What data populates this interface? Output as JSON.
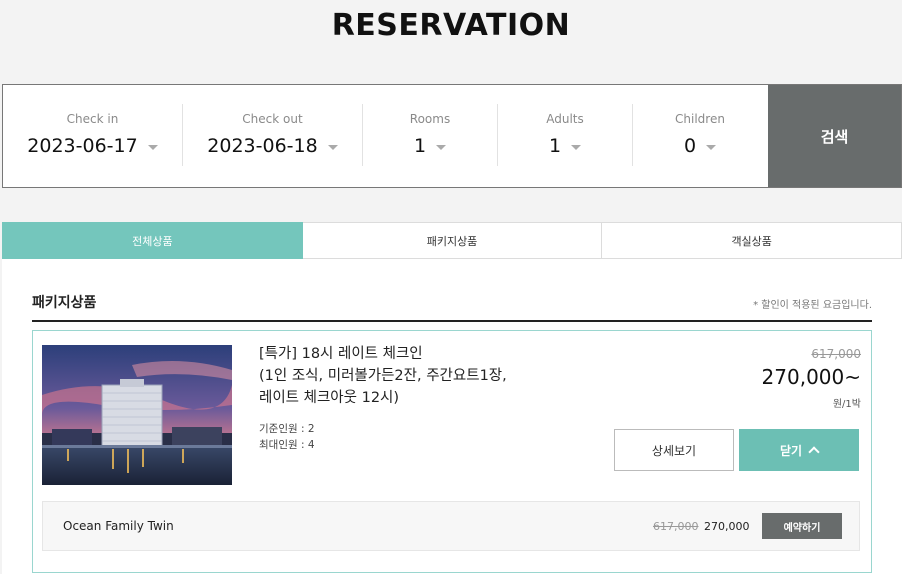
{
  "page": {
    "title": "RESERVATION"
  },
  "search": {
    "check_in": {
      "label": "Check in",
      "value": "2023-06-17"
    },
    "check_out": {
      "label": "Check out",
      "value": "2023-06-18"
    },
    "rooms": {
      "label": "Rooms",
      "value": "1"
    },
    "adults": {
      "label": "Adults",
      "value": "1"
    },
    "children": {
      "label": "Children",
      "value": "0"
    },
    "button_label": "검색"
  },
  "tabs": [
    {
      "label": "전체상품",
      "active": true
    },
    {
      "label": "패키지상품",
      "active": false
    },
    {
      "label": "객실상품",
      "active": false
    }
  ],
  "section": {
    "title": "패키지상품",
    "note": "* 할인이 적용된 요금입니다."
  },
  "product": {
    "title_line1": "[특가] 18시 레이트 체크인",
    "title_line2": "(1인 조식, 미러볼가든2잔, 주간요트1장,",
    "title_line3": "레이트 체크아웃 12시)",
    "base_guests": "기준인원 : 2",
    "max_guests": "최대인원 : 4",
    "original_price": "617,000",
    "sale_price": "270,000~",
    "price_unit": "원/1박",
    "detail_label": "상세보기",
    "close_label": "닫기"
  },
  "room": {
    "name": "Ocean Family Twin",
    "original_price": "617,000",
    "price": "270,000",
    "reserve_label": "예약하기"
  },
  "colors": {
    "accent": "#74c6bc",
    "dark_button": "#686c6c"
  }
}
